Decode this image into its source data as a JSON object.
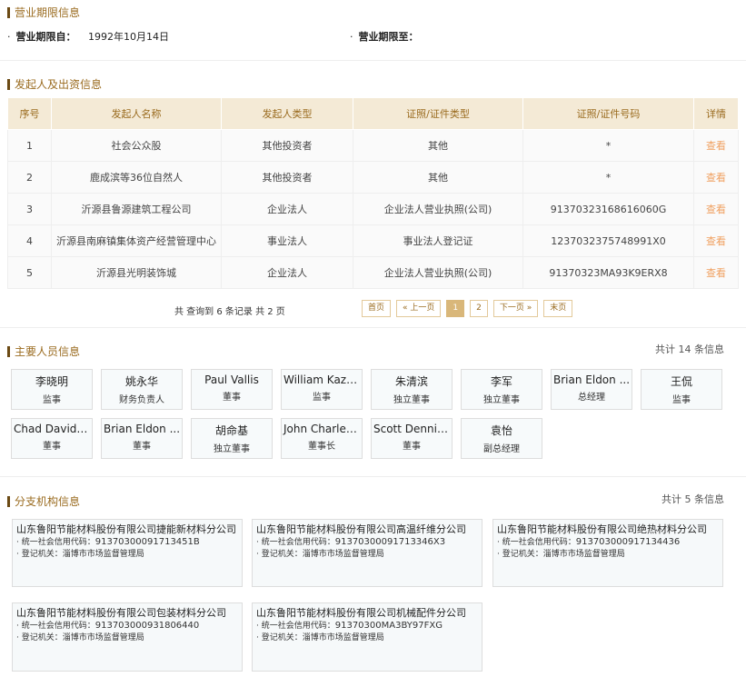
{
  "business_period": {
    "title": "营业期限信息",
    "from_label": "营业期限自：",
    "from_value": "1992年10月14日",
    "to_label": "营业期限至：",
    "to_value": ""
  },
  "investors": {
    "title": "发起人及出资信息",
    "columns": [
      "序号",
      "发起人名称",
      "发起人类型",
      "证照/证件类型",
      "证照/证件号码",
      "详情"
    ],
    "rows": [
      {
        "no": "1",
        "name": "社会公众股",
        "type": "其他投资者",
        "cert_type": "其他",
        "cert_no": "*",
        "detail": "查看"
      },
      {
        "no": "2",
        "name": "鹿成滨等36位自然人",
        "type": "其他投资者",
        "cert_type": "其他",
        "cert_no": "*",
        "detail": "查看"
      },
      {
        "no": "3",
        "name": "沂源县鲁源建筑工程公司",
        "type": "企业法人",
        "cert_type": "企业法人营业执照(公司)",
        "cert_no": "91370323168616060G",
        "detail": "查看"
      },
      {
        "no": "4",
        "name": "沂源县南麻镇集体资产经营管理中心",
        "type": "事业法人",
        "cert_type": "事业法人登记证",
        "cert_no": "1237032375748991X0",
        "detail": "查看"
      },
      {
        "no": "5",
        "name": "沂源县光明装饰城",
        "type": "企业法人",
        "cert_type": "企业法人营业执照(公司)",
        "cert_no": "91370323MA93K9ERX8",
        "detail": "查看"
      }
    ],
    "pager_info": "共 查询到 6 条记录 共 2 页",
    "pager": {
      "first": "首页",
      "prev": "« 上一页",
      "page1": "1",
      "page2": "2",
      "next": "下一页 »",
      "last": "末页"
    }
  },
  "staff": {
    "title": "主要人员信息",
    "count": "共计 14 条信息",
    "people": [
      {
        "name": "李晓明",
        "role": "监事"
      },
      {
        "name": "姚永华",
        "role": "财务负责人"
      },
      {
        "name": "Paul Vallis",
        "role": "董事"
      },
      {
        "name": "William Kaz P...",
        "role": "监事"
      },
      {
        "name": "朱清滨",
        "role": "独立董事"
      },
      {
        "name": "李军",
        "role": "独立董事"
      },
      {
        "name": "Brian Eldon ...",
        "role": "总经理"
      },
      {
        "name": "王侃",
        "role": "监事"
      },
      {
        "name": "Chad David C...",
        "role": "董事"
      },
      {
        "name": "Brian Eldon ...",
        "role": "董事"
      },
      {
        "name": "胡命基",
        "role": "独立董事"
      },
      {
        "name": "John Charles ...",
        "role": "董事长"
      },
      {
        "name": "Scott Dennis ...",
        "role": "董事"
      },
      {
        "name": "袁怡",
        "role": "副总经理"
      }
    ]
  },
  "branches": {
    "title": "分支机构信息",
    "count": "共计 5 条信息",
    "code_label": "· 统一社会信用代码：",
    "org_label": "· 登记机关：",
    "items": [
      {
        "name": "山东鲁阳节能材料股份有限公司捷能新材料分公司",
        "code": "91370300091713451B",
        "org": "淄博市市场监督管理局"
      },
      {
        "name": "山东鲁阳节能材料股份有限公司高温纤维分公司",
        "code": "91370300091713346X3",
        "org": "淄博市市场监督管理局"
      },
      {
        "name": "山东鲁阳节能材料股份有限公司绝热材料分公司",
        "code": "913703000917134436",
        "org": "淄博市市场监督管理局"
      },
      {
        "name": "山东鲁阳节能材料股份有限公司包装材料分公司",
        "code": "913703000931806440",
        "org": "淄博市市场监督管理局"
      },
      {
        "name": "山东鲁阳节能材料股份有限公司机械配件分公司",
        "code": "91370300MA3BY97FXG",
        "org": "淄博市市场监督管理局"
      }
    ]
  }
}
